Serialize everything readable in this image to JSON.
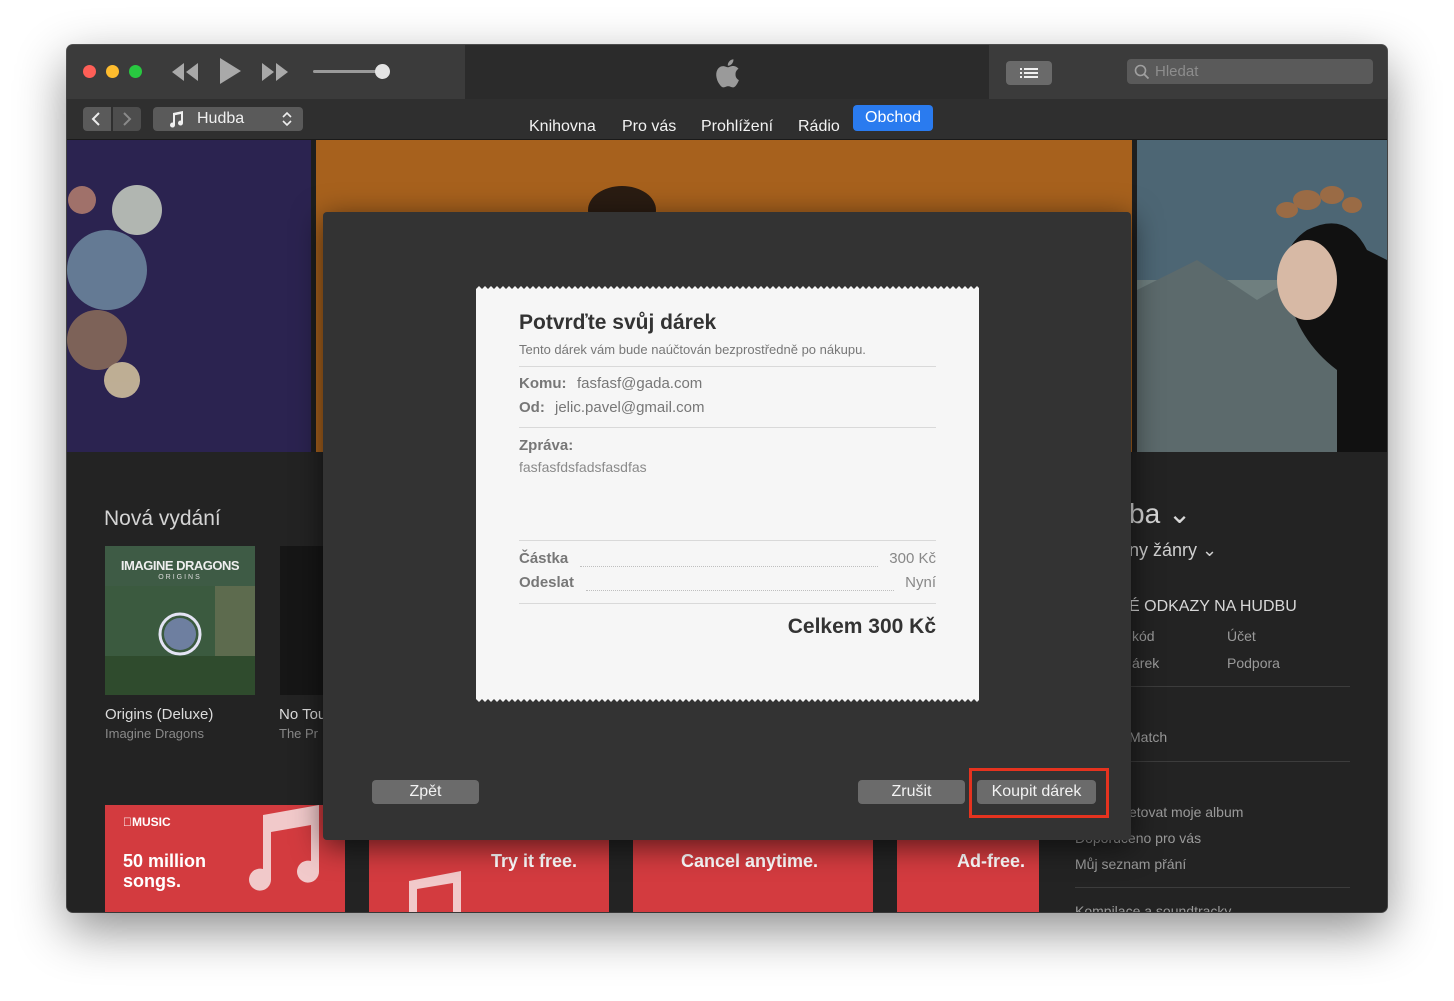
{
  "toolbar": {
    "search_placeholder": "Hledat"
  },
  "nav": {
    "media_kind": "Hudba",
    "tabs": [
      {
        "label": "Knihovna"
      },
      {
        "label": "Pro vás"
      },
      {
        "label": "Prohlížení"
      },
      {
        "label": "Rádio"
      },
      {
        "label": "Obchod",
        "active": true
      }
    ]
  },
  "store": {
    "section_title": "Nová vydání",
    "albums": [
      {
        "cover_text": "IMAGINE DRAGONS",
        "cover_subtext": "ORIGINS",
        "title": "Origins (Deluxe)",
        "artist": "Imagine Dragons"
      },
      {
        "title": "No Tou",
        "artist": "The Pr"
      }
    ],
    "promos": [
      "50 million songs.",
      "Try it free.",
      "Cancel anytime.",
      "Ad-free."
    ],
    "promo_brand": "MUSIC",
    "right": {
      "heading_fragment": "ba",
      "genres_fragment": "ny žánry",
      "links_heading": "É ODKAZY NA HUDBU",
      "links": [
        "kód",
        "Účet",
        "árek",
        "Podpora"
      ],
      "match": "Match",
      "account_links": [
        "etovat moje album",
        "Doporučeno pro vás",
        "Můj seznam přání"
      ],
      "bottom": "Kompilace a soundtracky"
    }
  },
  "dialog": {
    "title": "Potvrďte svůj dárek",
    "subtitle": "Tento dárek vám bude naúčtován bezprostředně po nákupu.",
    "to_label": "Komu:",
    "to_value": "fasfasf@gada.com",
    "from_label": "Od:",
    "from_value": "jelic.pavel@gmail.com",
    "message_label": "Zpráva:",
    "message_value": "fasfasfdsfadsfasdfas",
    "amount_label": "Částka",
    "amount_value": "300 Kč",
    "send_label": "Odeslat",
    "send_value": "Nyní",
    "total": "Celkem 300 Kč",
    "back_button": "Zpět",
    "cancel_button": "Zrušit",
    "buy_button": "Koupit dárek"
  },
  "colors": {
    "accent_tab": "#2a7bef",
    "highlight": "#e5331f",
    "promo_red": "#d33b3f"
  }
}
